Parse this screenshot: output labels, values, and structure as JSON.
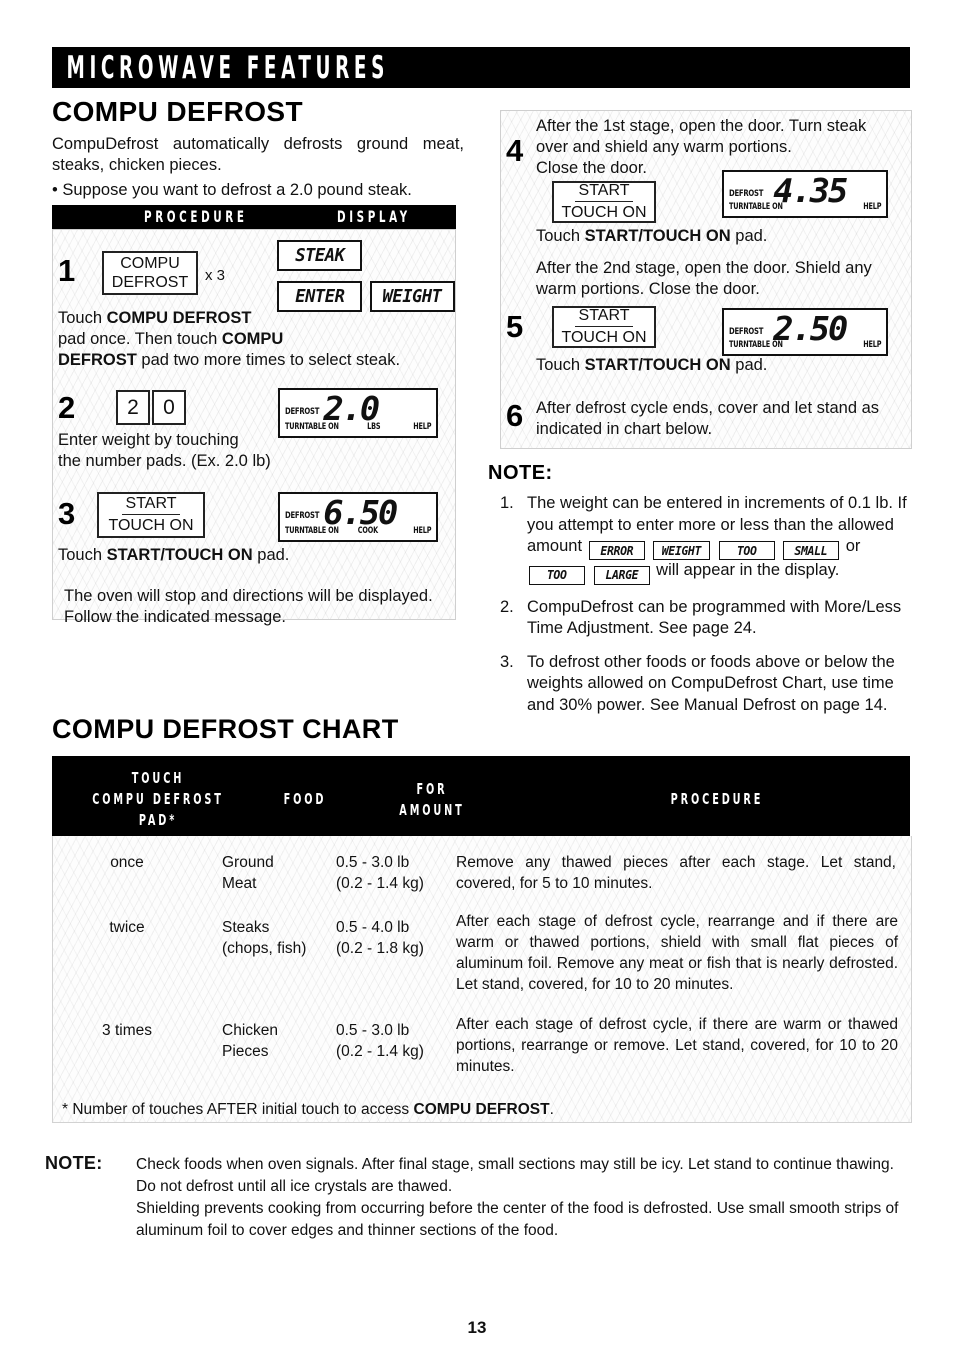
{
  "banner": {
    "title": "MICROWAVE FEATURES"
  },
  "section": {
    "title": "COMPU DEFROST",
    "intro": "CompuDefrost automatically defrosts ground meat, steaks, chicken pieces.",
    "bullet": "• Suppose you want to defrost a 2.0 pound steak."
  },
  "proc_table": {
    "col_procedure": "PROCEDURE",
    "col_display": "DISPLAY"
  },
  "steps": {
    "step1": {
      "number": "1",
      "pad_line1": "COMPU",
      "pad_line2": "DEFROST",
      "multiplier": "x 3",
      "text_html": "Touch <b>COMPU DEFROST</b><br>pad once. Then touch <b>COMPU</b><br><b>DEFROST</b> pad two more times to select steak.",
      "display_steak": "STEAK",
      "display_enter": "ENTER",
      "display_weight": "WEIGHT"
    },
    "step2": {
      "number": "2",
      "key_a": "2",
      "key_b": "0",
      "text_html": "Enter weight by touching<br>the number pads. (Ex. 2.0 lb)",
      "panel": {
        "defrost": "DEFROST",
        "value": "2.0",
        "turntable": "TURNTABLE ON",
        "mid": "LBS",
        "help": "HELP"
      }
    },
    "step3": {
      "number": "3",
      "pad_line1": "START",
      "pad_line2": "TOUCH ON",
      "text_html": "Touch <b>START/TOUCH ON</b> pad.",
      "panel": {
        "defrost": "DEFROST",
        "value": "6.50",
        "turntable": "TURNTABLE ON",
        "mid": "COOK",
        "help": "HELP"
      },
      "note_html": "The oven will stop and directions will be displayed.<br>Follow the indicated message."
    },
    "step4": {
      "number": "4",
      "text_html": "After the 1st stage, open the door. Turn steak<br>over and shield any warm portions.<br>Close the door.",
      "pad_line1": "START",
      "pad_line2": "TOUCH ON",
      "after_html": "Touch <b>START/TOUCH ON</b> pad.",
      "panel": {
        "defrost": "DEFROST",
        "value": "4.35",
        "turntable": "TURNTABLE ON",
        "mid": "",
        "help": "HELP"
      }
    },
    "step5": {
      "number": "5",
      "text_html": "After the 2nd stage, open the door. Shield any<br>warm portions. Close the door.",
      "pad_line1": "START",
      "pad_line2": "TOUCH ON",
      "after_html": "Touch <b>START/TOUCH ON</b> pad.",
      "panel": {
        "defrost": "DEFROST",
        "value": "2.50",
        "turntable": "TURNTABLE ON",
        "mid": "",
        "help": "HELP"
      }
    },
    "step6": {
      "number": "6",
      "text_html": "After defrost cycle ends, cover and let stand as<br>indicated in chart below."
    }
  },
  "note_right": {
    "heading": "NOTE:",
    "items": [
      {
        "marker": "1.",
        "html": "The weight can be entered in increments of 0.1 lb. If you attempt to enter more or less than the allowed amount <span class=\"lcd-chip\"><span>ERROR</span></span> <span class=\"lcd-chip\"><span>WEIGHT</span></span> <span class=\"lcd-chip\"><span>TOO</span></span> <span class=\"lcd-chip\"><span>SMALL</span></span> or <span class=\"lcd-chip\"><span>TOO</span></span> <span class=\"lcd-chip\"><span>LARGE</span></span> will appear in the display."
      },
      {
        "marker": "2.",
        "html": "CompuDefrost can be programmed with More/Less Time Adjustment. See page 24."
      },
      {
        "marker": "3.",
        "html": "To defrost other foods or foods above or below the weights allowed on CompuDefrost Chart, use time and 30% power. See Manual Defrost on page 14."
      }
    ]
  },
  "chart": {
    "title": "COMPU DEFROST CHART",
    "headers": {
      "touch_pad": "TOUCH\nCOMPU DEFROST\nPAD*",
      "food": "FOOD",
      "for_amount": "FOR\nAMOUNT",
      "procedure": "PROCEDURE"
    },
    "rows": [
      {
        "touch": "once",
        "food_line1": "Ground",
        "food_line2": "Meat",
        "amount_lb": "0.5 - 3.0 lb",
        "amount_kg": "(0.2 - 1.4 kg)",
        "procedure": "Remove any thawed pieces after each stage. Let stand, covered, for 5 to 10 minutes."
      },
      {
        "touch": "twice",
        "food_line1": "Steaks",
        "food_line2": "(chops, fish)",
        "amount_lb": "0.5 - 4.0 lb",
        "amount_kg": "(0.2 - 1.8 kg)",
        "procedure": "After each stage of defrost cycle, rearrange and if there are warm or thawed portions, shield with small flat pieces of aluminum foil. Remove any meat or fish that is nearly defrosted. Let stand, covered, for 10 to 20 minutes."
      },
      {
        "touch": "3 times",
        "food_line1": "Chicken",
        "food_line2": "Pieces",
        "amount_lb": "0.5 - 3.0 lb",
        "amount_kg": "(0.2 - 1.4 kg)",
        "procedure": "After each stage of defrost cycle, if there are warm or thawed portions, rearrange or remove. Let stand, covered, for 10 to 20 minutes."
      }
    ],
    "footnote_html": "* Number of touches AFTER initial touch to access <b>COMPU DEFROST</b>."
  },
  "note_bottom": {
    "label": "NOTE:",
    "paragraph1": "Check foods when oven signals. After final stage, small sections may still be icy. Let stand to continue thawing. Do not defrost until all ice crystals are thawed.",
    "paragraph2": "Shielding prevents cooking from occurring before the center of the food is defrosted. Use small smooth strips of aluminum foil to cover edges and thinner sections of the food."
  },
  "page_number": "13"
}
